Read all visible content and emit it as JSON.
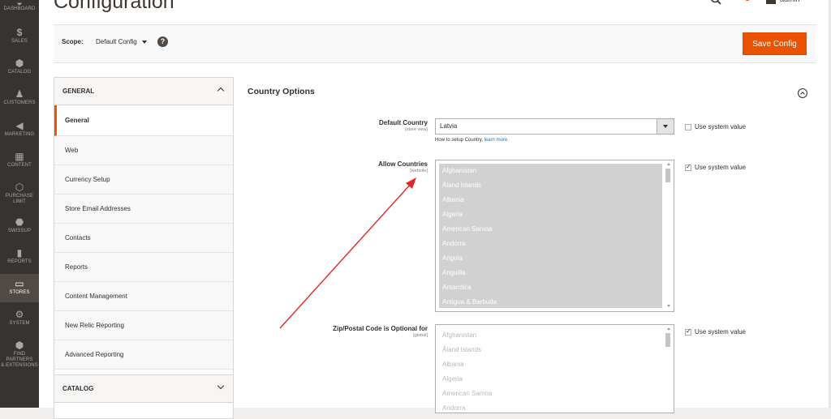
{
  "nav": {
    "items": [
      {
        "label": "DASHBOARD",
        "icon": "gauge-icon"
      },
      {
        "label": "SALES",
        "icon": "dollar-icon"
      },
      {
        "label": "CATALOG",
        "icon": "cube-icon"
      },
      {
        "label": "CUSTOMERS",
        "icon": "person-icon"
      },
      {
        "label": "MARKETING",
        "icon": "megaphone-icon"
      },
      {
        "label": "CONTENT",
        "icon": "layout-icon"
      },
      {
        "label": "PURCHASE",
        "label2": "LIMIT",
        "icon": "hexagon-icon"
      },
      {
        "label": "SWISSUP",
        "icon": "swissup-icon"
      },
      {
        "label": "REPORTS",
        "icon": "bar-chart-icon"
      },
      {
        "label": "STORES",
        "icon": "store-icon"
      },
      {
        "label": "SYSTEM",
        "icon": "gear-icon"
      },
      {
        "label": "FIND PARTNERS",
        "label2": "& EXTENSIONS",
        "icon": "box-icon"
      }
    ]
  },
  "header": {
    "title": "Configuration",
    "user": "admin"
  },
  "scope": {
    "label": "Scope:",
    "value": "Default Config",
    "help": "?",
    "save_label": "Save Config"
  },
  "sidebar": {
    "general_header": "GENERAL",
    "items": [
      {
        "label": "General",
        "active": true
      },
      {
        "label": "Web"
      },
      {
        "label": "Currency Setup"
      },
      {
        "label": "Store Email Addresses"
      },
      {
        "label": "Contacts"
      },
      {
        "label": "Reports"
      },
      {
        "label": "Content Management"
      },
      {
        "label": "New Relic Reporting"
      },
      {
        "label": "Advanced Reporting"
      }
    ],
    "catalog_header": "CATALOG"
  },
  "section": {
    "title": "Country Options",
    "default_country": {
      "label": "Default Country",
      "scope": "[store view]",
      "value": "Latvia",
      "note_prefix": "How to setup Country,",
      "note_link": "learn more",
      "note_suffix": ".",
      "use_system": "Use system value",
      "use_system_checked": false
    },
    "allow_countries": {
      "label": "Allow Countries",
      "scope": "[website]",
      "use_system": "Use system value",
      "use_system_checked": true,
      "options": [
        "Afghanistan",
        "Åland Islands",
        "Albania",
        "Algeria",
        "American Samoa",
        "Andorra",
        "Angola",
        "Anguilla",
        "Antarctica",
        "Antigua & Barbuda"
      ]
    },
    "zip_optional": {
      "label": "Zip/Postal Code is Optional for",
      "scope": "[global]",
      "use_system": "Use system value",
      "use_system_checked": true,
      "options": [
        "Afghanistan",
        "Åland Islands",
        "Albania",
        "Algeria",
        "American Samoa",
        "Andorra"
      ]
    }
  },
  "colors": {
    "accent": "#eb5202",
    "nav_bg": "#373330",
    "annotation_arrow": "#e8242a"
  }
}
